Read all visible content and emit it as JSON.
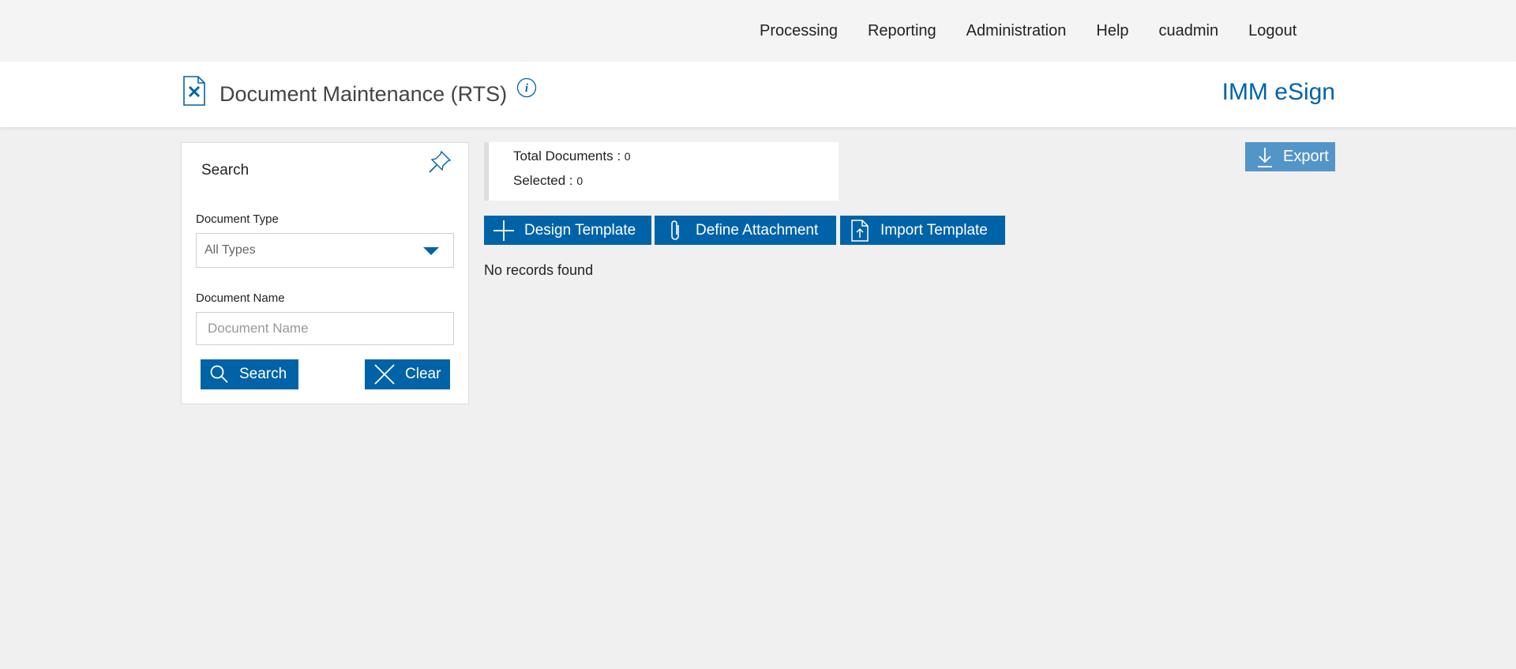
{
  "nav": {
    "items": [
      "Processing",
      "Reporting",
      "Administration",
      "Help",
      "cuadmin",
      "Logout"
    ]
  },
  "header": {
    "title": "Document Maintenance (RTS)",
    "brand": "IMM eSign",
    "info_icon": "info-icon",
    "doc_icon": "document-tools-icon"
  },
  "search": {
    "title": "Search",
    "document_type_label": "Document Type",
    "document_type_value": "All Types",
    "document_name_label": "Document Name",
    "document_name_placeholder": "Document Name",
    "document_name_value": "",
    "search_button": "Search",
    "clear_button": "Clear"
  },
  "summary": {
    "total_label": "Total Documents : ",
    "total_value": "0",
    "selected_label": "Selected : ",
    "selected_value": "0"
  },
  "toolbar": {
    "export": "Export",
    "design_template": "Design Template",
    "define_attachment": "Define Attachment",
    "import_template": "Import Template"
  },
  "results": {
    "empty_message": "No records found"
  },
  "colors": {
    "primary": "#0063a7",
    "export_button": "#5495c8",
    "page_background": "#f0f0f0"
  }
}
